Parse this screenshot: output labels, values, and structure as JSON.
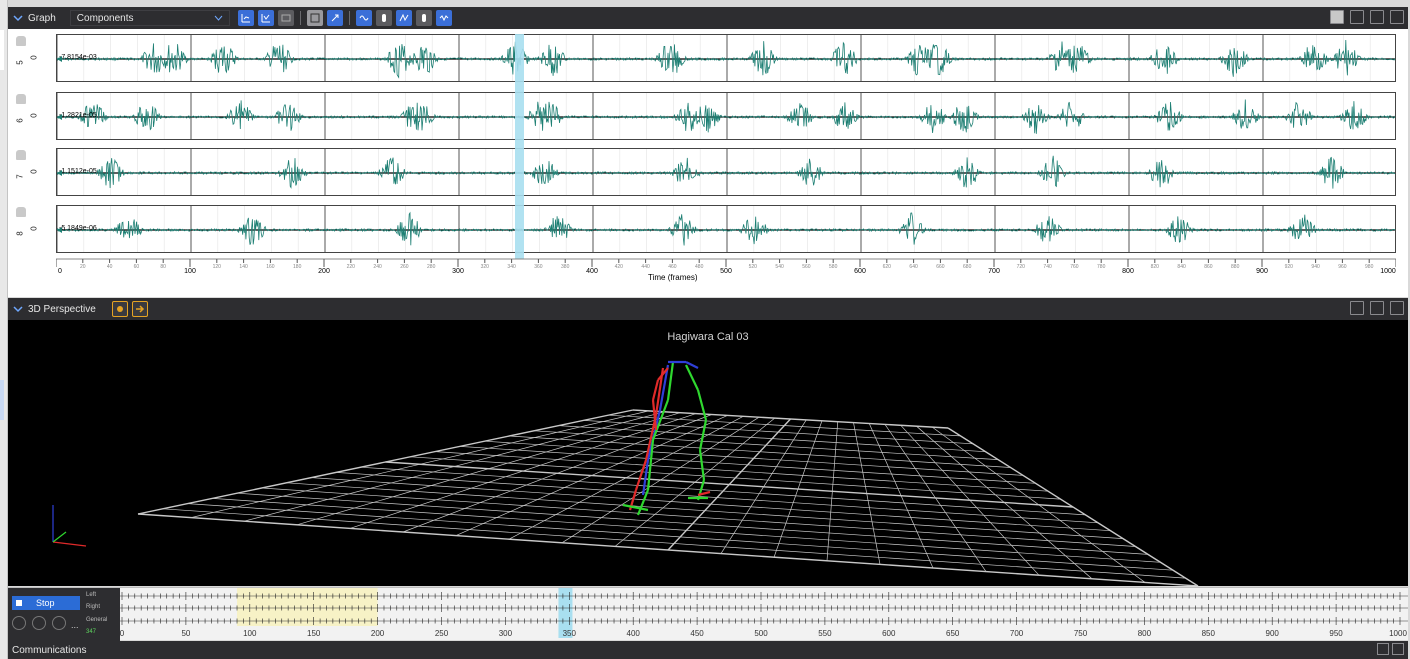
{
  "graph_panel": {
    "title": "Graph",
    "view_mode": "Components",
    "rows": [
      {
        "label": "5",
        "zero_label": "0",
        "value": "-7.8154e-03"
      },
      {
        "label": "6",
        "zero_label": "0",
        "value": "-1.2821e-05"
      },
      {
        "label": "7",
        "zero_label": "0",
        "value": "-1.1512e-05"
      },
      {
        "label": "8",
        "zero_label": "0",
        "value": "-5.1849e-06"
      }
    ],
    "x_axis_title": "Time (frames)",
    "x_major_ticks": [
      "0",
      "100",
      "200",
      "300",
      "400",
      "500",
      "600",
      "700",
      "800",
      "900",
      "1000"
    ],
    "x_minor_ticks": [
      "20",
      "40",
      "60",
      "80",
      "120",
      "140",
      "160",
      "180",
      "220",
      "240",
      "260",
      "280",
      "320",
      "340",
      "360",
      "380",
      "420",
      "440",
      "460",
      "480",
      "520",
      "540",
      "560",
      "580",
      "620",
      "640",
      "660",
      "680",
      "720",
      "740",
      "760",
      "780",
      "820",
      "840",
      "860",
      "880",
      "920",
      "940",
      "960",
      "980"
    ],
    "cursor_frame": 347,
    "signal_color": "#1d7f73",
    "cursor_color": "#a9dff0"
  },
  "perspective_panel": {
    "title": "3D Perspective",
    "scene_title": "Hagiwara Cal 03"
  },
  "timeline": {
    "stop_label": "Stop",
    "tracks": [
      "Left",
      "Right",
      "General"
    ],
    "current_frame": "347",
    "tick_labels": [
      "0",
      "50",
      "100",
      "150",
      "200",
      "250",
      "300",
      "350",
      "400",
      "450",
      "500",
      "550",
      "600",
      "650",
      "700",
      "750",
      "800",
      "850",
      "900",
      "950",
      "1000"
    ],
    "highlight_range": [
      90,
      200
    ],
    "cursor_frame": 347,
    "highlight_color": "#f7f2c6"
  },
  "communications": {
    "title": "Communications"
  },
  "chart_data": {
    "type": "line",
    "xlabel": "Time (frames)",
    "xlim": [
      0,
      1000
    ],
    "series": [
      {
        "name": "5",
        "baseline": 0
      },
      {
        "name": "6",
        "baseline": 0
      },
      {
        "name": "7",
        "baseline": 0
      },
      {
        "name": "8",
        "baseline": 0
      }
    ]
  }
}
